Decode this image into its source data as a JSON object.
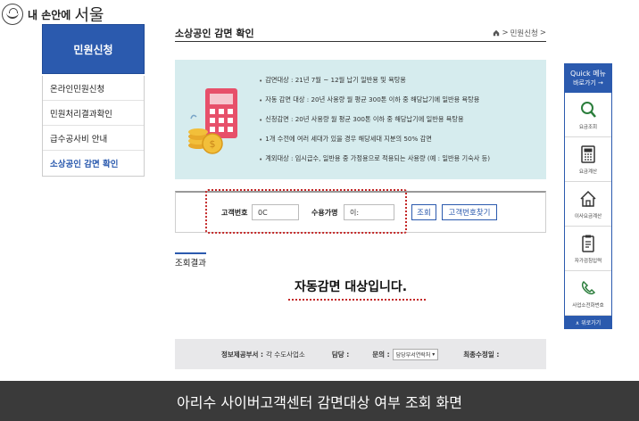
{
  "logo": {
    "small": "내 손안에",
    "big": "서울"
  },
  "sidebar": {
    "heading": "민원신청",
    "items": [
      {
        "label": "온라인민원신청"
      },
      {
        "label": "민원처리결과확인"
      },
      {
        "label": "급수공사비 안내"
      },
      {
        "label": "소상공인 감면 확인"
      }
    ]
  },
  "header": {
    "title": "소상공인 감면 확인",
    "breadcrumb_home_icon": "home-icon",
    "breadcrumb_sep": ">",
    "breadcrumb_item": "민원신청",
    "breadcrumb_tail": ">"
  },
  "info": {
    "items": [
      "감면대상 : 21년 7월 ~ 12월 납기 일반용 및 욕탕용",
      "자동 감면 대상 : 20년 사용량 월 평균 300톤 이하 중 해당납기에 일반용 욕탕용",
      "신청감면 : 20년 사용량 월 평균 300톤 이하 중 해당납기에 일반용 욕탕용",
      "1개 수전에 여러 세대가 있을 경우 해당세대 지분의 50% 감면",
      "계외대상 : 임시급수, 일반용 중 가정용으로 적용되는 사용량 (예 : 일반용 기숙사 등)"
    ]
  },
  "search": {
    "customer_label": "고객번호",
    "customer_value": "0C",
    "name_label": "수용가명",
    "name_value": "이:",
    "search_button": "조회",
    "find_button": "고객번호찾기"
  },
  "result": {
    "label": "조회결과",
    "message": "자동감면 대상입니다."
  },
  "footer": {
    "provider_label": "정보제공부서 :",
    "provider_value": "각 수도사업소",
    "manager_label": "담당 :",
    "inquiry_label": "문의 :",
    "inquiry_select": "담당부서연락처",
    "updated_label": "최종수정일 :"
  },
  "quick": {
    "title": "Quick 메뉴",
    "subtitle": "바로가기 →",
    "items": [
      {
        "label": "요금조회",
        "icon": "magnifier-icon"
      },
      {
        "label": "요금계산",
        "icon": "calculator-icon"
      },
      {
        "label": "이사요금계산",
        "icon": "house-icon"
      },
      {
        "label": "자가검침입력",
        "icon": "clipboard-icon"
      },
      {
        "label": "사업소전화번호",
        "icon": "phone-icon"
      }
    ],
    "top_button": "∧ 위로가기"
  },
  "caption": "아리수 사이버고객센터 감면대상 여부 조회 화면",
  "colors": {
    "primary": "#2b5aae",
    "info_bg": "#d6ecee",
    "highlight_red": "#c42828",
    "caption_bg": "#3a3a3a"
  }
}
